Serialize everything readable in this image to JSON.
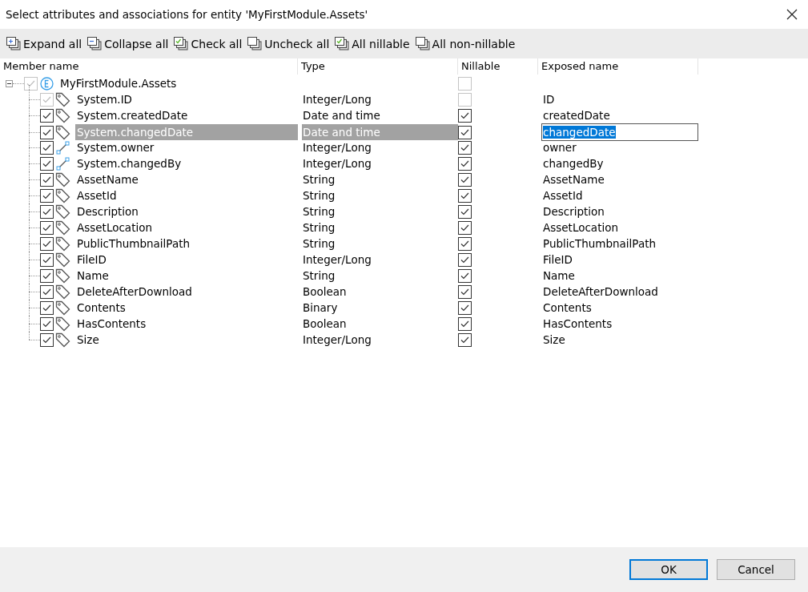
{
  "window": {
    "title": "Select attributes and associations for entity 'MyFirstModule.Assets'"
  },
  "toolbar": [
    {
      "kind": "expand",
      "label": "Expand all"
    },
    {
      "kind": "collapse",
      "label": "Collapse all"
    },
    {
      "kind": "check",
      "label": "Check all"
    },
    {
      "kind": "uncheck",
      "label": "Uncheck all"
    },
    {
      "kind": "check",
      "label": "All nillable"
    },
    {
      "kind": "uncheck",
      "label": "All non-nillable"
    }
  ],
  "columns": [
    "Member name",
    "Type",
    "Nillable",
    "Exposed name"
  ],
  "tree": {
    "name": "MyFirstModule.Assets",
    "expanded": true,
    "checked": true,
    "disabled": true,
    "nillable": false,
    "nillable_disabled": true,
    "children": [
      {
        "kind": "attribute",
        "name": "System.ID",
        "type": "Integer/Long",
        "checked": true,
        "disabled": true,
        "nillable": false,
        "nillable_disabled": true,
        "exposed": "ID",
        "selected": false
      },
      {
        "kind": "attribute",
        "name": "System.createdDate",
        "type": "Date and time",
        "checked": true,
        "disabled": false,
        "nillable": true,
        "nillable_disabled": false,
        "exposed": "createdDate",
        "selected": false
      },
      {
        "kind": "attribute",
        "name": "System.changedDate",
        "type": "Date and time",
        "checked": true,
        "disabled": false,
        "nillable": true,
        "nillable_disabled": false,
        "exposed": "changedDate",
        "selected": true
      },
      {
        "kind": "association",
        "name": "System.owner",
        "type": "Integer/Long",
        "checked": true,
        "disabled": false,
        "nillable": true,
        "nillable_disabled": false,
        "exposed": "owner",
        "selected": false
      },
      {
        "kind": "association",
        "name": "System.changedBy",
        "type": "Integer/Long",
        "checked": true,
        "disabled": false,
        "nillable": true,
        "nillable_disabled": false,
        "exposed": "changedBy",
        "selected": false
      },
      {
        "kind": "attribute",
        "name": "AssetName",
        "type": "String",
        "checked": true,
        "disabled": false,
        "nillable": true,
        "nillable_disabled": false,
        "exposed": "AssetName",
        "selected": false
      },
      {
        "kind": "attribute",
        "name": "AssetId",
        "type": "String",
        "checked": true,
        "disabled": false,
        "nillable": true,
        "nillable_disabled": false,
        "exposed": "AssetId",
        "selected": false
      },
      {
        "kind": "attribute",
        "name": "Description",
        "type": "String",
        "checked": true,
        "disabled": false,
        "nillable": true,
        "nillable_disabled": false,
        "exposed": "Description",
        "selected": false
      },
      {
        "kind": "attribute",
        "name": "AssetLocation",
        "type": "String",
        "checked": true,
        "disabled": false,
        "nillable": true,
        "nillable_disabled": false,
        "exposed": "AssetLocation",
        "selected": false
      },
      {
        "kind": "attribute",
        "name": "PublicThumbnailPath",
        "type": "String",
        "checked": true,
        "disabled": false,
        "nillable": true,
        "nillable_disabled": false,
        "exposed": "PublicThumbnailPath",
        "selected": false
      },
      {
        "kind": "attribute",
        "name": "FileID",
        "type": "Integer/Long",
        "checked": true,
        "disabled": false,
        "nillable": true,
        "nillable_disabled": false,
        "exposed": "FileID",
        "selected": false
      },
      {
        "kind": "attribute",
        "name": "Name",
        "type": "String",
        "checked": true,
        "disabled": false,
        "nillable": true,
        "nillable_disabled": false,
        "exposed": "Name",
        "selected": false
      },
      {
        "kind": "attribute",
        "name": "DeleteAfterDownload",
        "type": "Boolean",
        "checked": true,
        "disabled": false,
        "nillable": true,
        "nillable_disabled": false,
        "exposed": "DeleteAfterDownload",
        "selected": false
      },
      {
        "kind": "attribute",
        "name": "Contents",
        "type": "Binary",
        "checked": true,
        "disabled": false,
        "nillable": true,
        "nillable_disabled": false,
        "exposed": "Contents",
        "selected": false
      },
      {
        "kind": "attribute",
        "name": "HasContents",
        "type": "Boolean",
        "checked": true,
        "disabled": false,
        "nillable": true,
        "nillable_disabled": false,
        "exposed": "HasContents",
        "selected": false
      },
      {
        "kind": "attribute",
        "name": "Size",
        "type": "Integer/Long",
        "checked": true,
        "disabled": false,
        "nillable": true,
        "nillable_disabled": false,
        "exposed": "Size",
        "selected": false
      }
    ]
  },
  "buttons": [
    {
      "label": "OK",
      "default": true
    },
    {
      "label": "Cancel",
      "default": false
    }
  ]
}
